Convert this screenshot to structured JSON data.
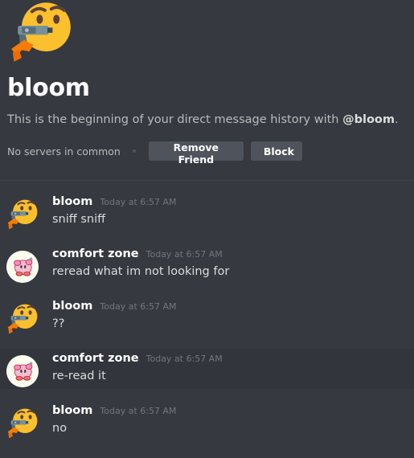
{
  "intro": {
    "name": "bloom",
    "description_prefix": "This is the beginning of your direct message history with ",
    "description_handle": "@bloom",
    "description_suffix": ".",
    "mutual_servers": "No servers in common",
    "remove_friend_label": "Remove Friend",
    "block_label": "Block"
  },
  "messages": [
    {
      "author": "bloom",
      "time": "Today at 6:57 AM",
      "text": "sniff sniff",
      "avatar": "thinking-gun-emoji-icon"
    },
    {
      "author": "comfort zone",
      "time": "Today at 6:57 AM",
      "text": "reread what im not looking for",
      "avatar": "kirby-avatar-icon"
    },
    {
      "author": "bloom",
      "time": "Today at 6:57 AM",
      "text": "??",
      "avatar": "thinking-gun-emoji-icon"
    },
    {
      "author": "comfort zone",
      "time": "Today at 6:57 AM",
      "text": "re-read it",
      "avatar": "kirby-avatar-icon"
    },
    {
      "author": "bloom",
      "time": "Today at 6:57 AM",
      "text": "no",
      "avatar": "thinking-gun-emoji-icon"
    }
  ],
  "colors": {
    "background": "#36393f",
    "hover_row": "#32353b",
    "button": "#4f545c",
    "username": "#ffffff",
    "timestamp": "#72767d",
    "emoji_face": "#fbc02d",
    "gun_hand": "#f57c00"
  }
}
